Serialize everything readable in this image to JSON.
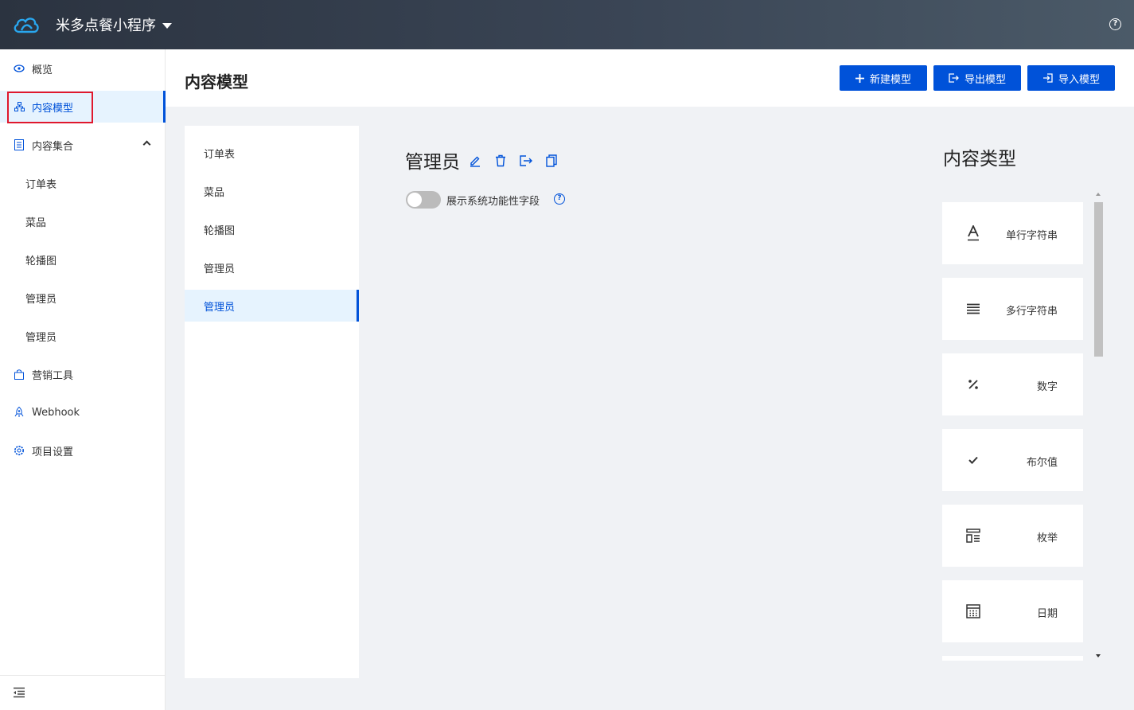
{
  "topbar": {
    "app_name": "米多点餐小程序"
  },
  "sidebar": {
    "items": [
      {
        "label": "概览",
        "icon": "eye-icon"
      },
      {
        "label": "内容模型",
        "icon": "sitemap-icon"
      },
      {
        "label": "内容集合",
        "icon": "list-icon"
      },
      {
        "label": "订单表"
      },
      {
        "label": "菜品"
      },
      {
        "label": "轮播图"
      },
      {
        "label": "管理员"
      },
      {
        "label": "管理员"
      },
      {
        "label": "营销工具",
        "icon": "bag-icon"
      },
      {
        "label": "Webhook",
        "icon": "rocket-icon"
      },
      {
        "label": "项目设置",
        "icon": "gear-icon"
      }
    ]
  },
  "header": {
    "title": "内容模型",
    "buttons": {
      "new": "新建模型",
      "export": "导出模型",
      "import": "导入模型"
    }
  },
  "models": [
    "订单表",
    "菜品",
    "轮播图",
    "管理员",
    "管理员"
  ],
  "detail": {
    "name": "管理员",
    "toggle_label": "展示系统功能性字段",
    "toggle_on": false
  },
  "content_types": {
    "title": "内容类型",
    "items": [
      {
        "label": "单行字符串",
        "icon": "text-a-icon"
      },
      {
        "label": "多行字符串",
        "icon": "lines-icon"
      },
      {
        "label": "数字",
        "icon": "percent-icon"
      },
      {
        "label": "布尔值",
        "icon": "check-icon"
      },
      {
        "label": "枚举",
        "icon": "enum-icon"
      },
      {
        "label": "日期",
        "icon": "calendar-icon"
      }
    ]
  },
  "colors": {
    "primary": "#0052d9",
    "highlight_border": "#e0182d",
    "active_bg": "#e6f3fe"
  }
}
